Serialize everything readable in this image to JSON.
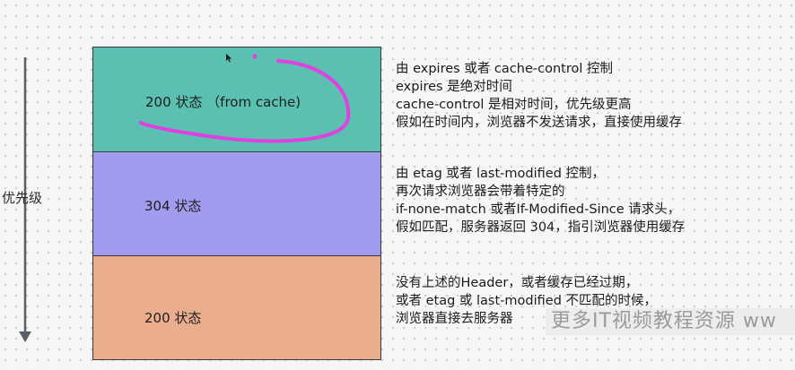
{
  "priority_label": "优先级",
  "boxes": [
    {
      "label": "200 状态 （from cache)",
      "color": "#5bbfb1"
    },
    {
      "label": "304 状态",
      "color": "#a29cee"
    },
    {
      "label": "200 状态",
      "color": "#eaae8e"
    }
  ],
  "descriptions": [
    {
      "lines": [
        "由 expires 或者 cache-control 控制",
        "expires 是绝对时间",
        "cache-control 是相对时间，优先级更高",
        "假如在时间内，浏览器不发送请求，直接使用缓存"
      ]
    },
    {
      "lines": [
        "由 etag 或者 last-modified 控制，",
        "再次请求浏览器会带着特定的",
        "if-none-match 或者If-Modified-Since 请求头，",
        "假如匹配，服务器返回 304，指引浏览器使用缓存"
      ]
    },
    {
      "lines": [
        "没有上述的Header，或者缓存已经过期，",
        "或者 etag 或 last-modified 不匹配的时候，",
        "浏览器直接去服务器"
      ]
    }
  ],
  "watermark": "更多IT视频教程资源 ww",
  "colors": {
    "axis": "#5a5e66",
    "pen": "#e040e0",
    "border": "#3a3a3a"
  },
  "icons": [
    "arrow-down-icon",
    "mouse-cursor-icon"
  ]
}
